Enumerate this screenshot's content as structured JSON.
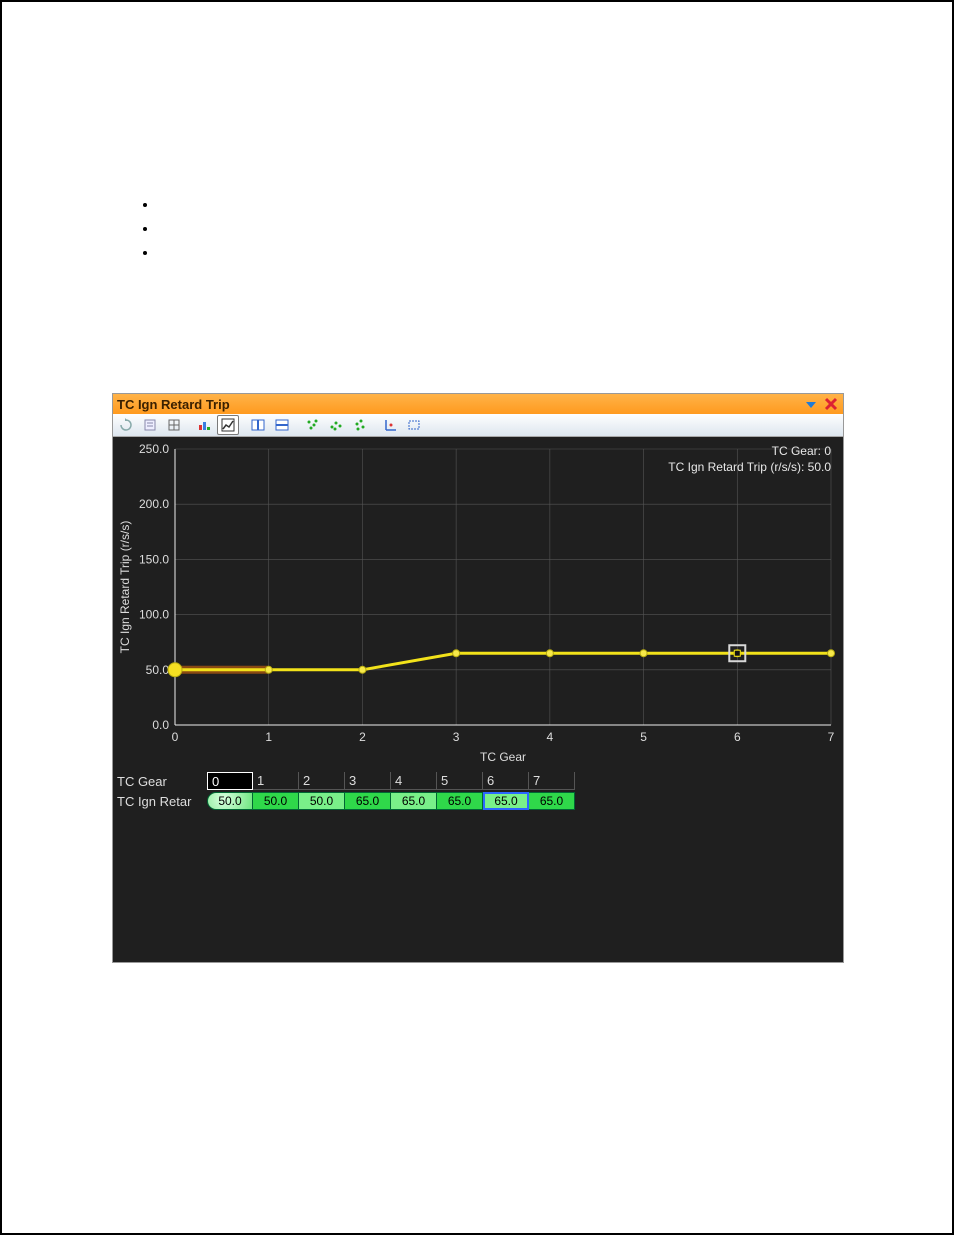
{
  "panel": {
    "title": "TC Ign Retard Trip",
    "overlay": {
      "line1": "TC Gear: 0",
      "line2": "TC Ign Retard Trip (r/s/s): 50.0"
    },
    "row_labels": {
      "x": "TC Gear",
      "y": "TC Ign Retar"
    }
  },
  "chart_data": {
    "type": "line",
    "title": "TC Ign Retard Trip",
    "xlabel": "TC Gear",
    "ylabel": "TC Ign Retard Trip (r/s/s)",
    "xlim": [
      0,
      7
    ],
    "ylim": [
      0,
      250
    ],
    "x": [
      0,
      1,
      2,
      3,
      4,
      5,
      6,
      7
    ],
    "y": [
      50.0,
      50.0,
      50.0,
      65.0,
      65.0,
      65.0,
      65.0,
      65.0
    ],
    "x_ticks": [
      "0",
      "1",
      "2",
      "3",
      "4",
      "5",
      "6",
      "7"
    ],
    "y_ticks": [
      "0.0",
      "50.0",
      "100.0",
      "150.0",
      "200.0",
      "250.0"
    ],
    "selected_index": 6,
    "origin_marker_index": 0,
    "highlight_segment": [
      0,
      1
    ]
  },
  "table": {
    "header": [
      "0",
      "1",
      "2",
      "3",
      "4",
      "5",
      "6",
      "7"
    ],
    "values": [
      "50.0",
      "50.0",
      "50.0",
      "65.0",
      "65.0",
      "65.0",
      "65.0",
      "65.0"
    ],
    "selected_header": 0,
    "selected_value": 6
  },
  "toolbar": {
    "items": [
      {
        "name": "refresh-icon"
      },
      {
        "name": "note-icon"
      },
      {
        "name": "grid-icon"
      },
      {
        "name": "bars-icon"
      },
      {
        "name": "chart-icon",
        "active": true
      },
      {
        "name": "split-h-icon"
      },
      {
        "name": "split-v-icon"
      },
      {
        "name": "scatter1-icon"
      },
      {
        "name": "scatter2-icon"
      },
      {
        "name": "scatter3-icon"
      },
      {
        "name": "axis-icon"
      },
      {
        "name": "select-icon"
      }
    ]
  }
}
